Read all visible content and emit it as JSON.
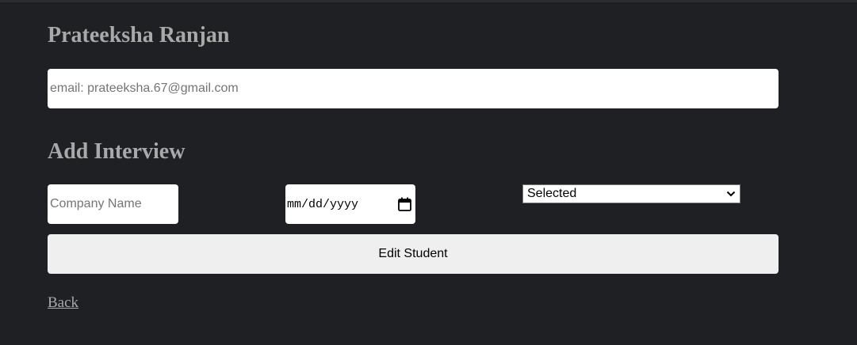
{
  "student": {
    "name": "Prateeksha Ranjan",
    "email_text": "email: prateeksha.67@gmail.com"
  },
  "interview_section": {
    "heading": "Add Interview",
    "company_input": {
      "placeholder": "Company Name",
      "value": ""
    },
    "date_input": {
      "display": "mm/dd/yyyy",
      "icon": "calendar-icon"
    },
    "status_select": {
      "selected": "Selected",
      "icon": "chevron-down-icon"
    },
    "submit_label": "Edit Student"
  },
  "nav": {
    "back_label": "Back"
  },
  "colors": {
    "background": "#1f2024",
    "heading_text": "#a9a9a9",
    "button_bg": "#efefef",
    "input_bg": "#ffffff"
  }
}
